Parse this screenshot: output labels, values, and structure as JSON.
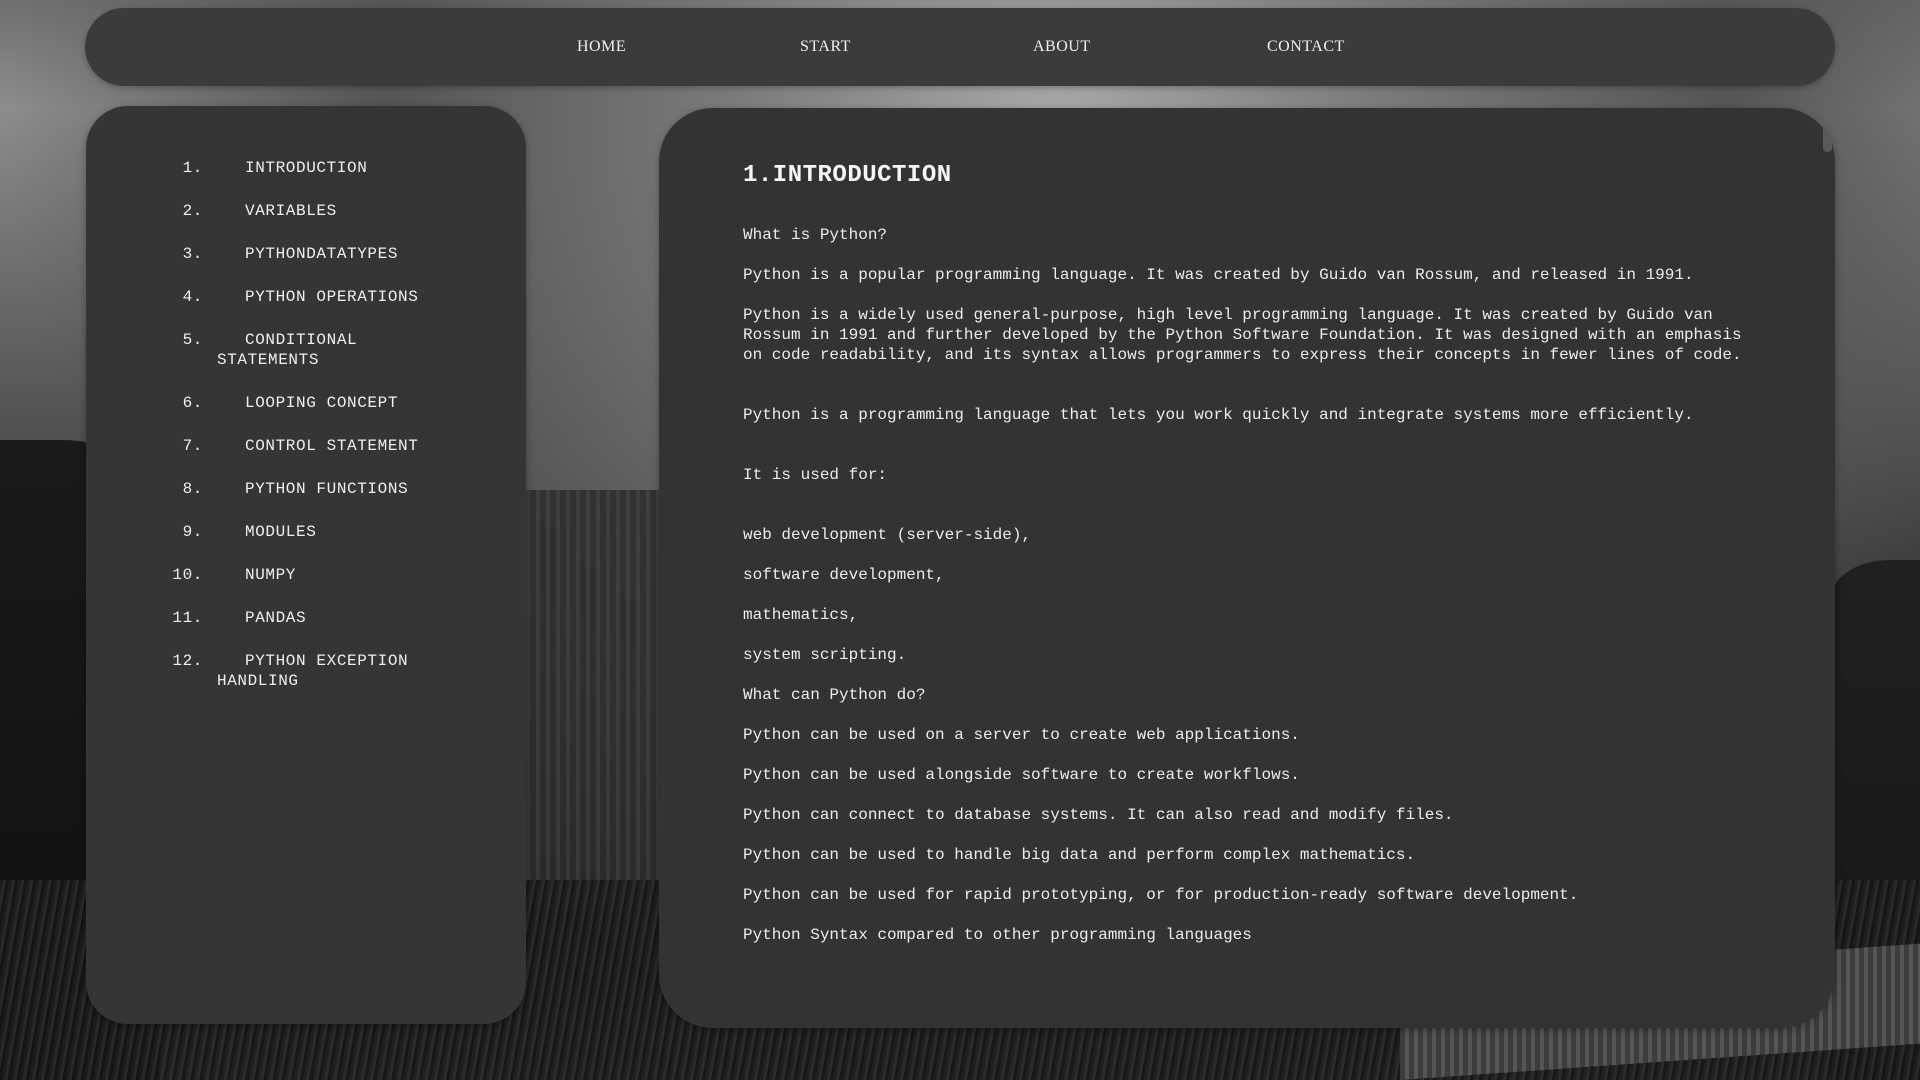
{
  "nav": {
    "items": [
      "HOME",
      "START",
      "ABOUT",
      "CONTACT"
    ]
  },
  "sidebar": {
    "items": [
      {
        "num": "1.",
        "label": "INTRODUCTION"
      },
      {
        "num": "2.",
        "label": "VARIABLES"
      },
      {
        "num": "3.",
        "label": "PYTHONDATATYPES"
      },
      {
        "num": "4.",
        "label": "PYTHON OPERATIONS"
      },
      {
        "num": "5.",
        "label": "CONDITIONAL STATEMENTS"
      },
      {
        "num": "6.",
        "label": "LOOPING CONCEPT"
      },
      {
        "num": "7.",
        "label": "CONTROL STATEMENT"
      },
      {
        "num": "8.",
        "label": "PYTHON FUNCTIONS"
      },
      {
        "num": "9.",
        "label": "MODULES"
      },
      {
        "num": "10.",
        "label": "NUMPY"
      },
      {
        "num": "11.",
        "label": "PANDAS"
      },
      {
        "num": "12.",
        "label": "PYTHON EXCEPTION HANDLING"
      }
    ]
  },
  "main": {
    "title": "1.INTRODUCTION",
    "paragraphs": [
      "What is Python?",
      "Python is a popular programming language. It was created by Guido van Rossum, and released in 1991.",
      "Python is a widely used general-purpose, high level programming language. It was created by Guido van Rossum in 1991 and further developed by the Python Software Foundation. It was designed with an emphasis on code readability, and its syntax allows programmers to express their concepts in fewer lines of code.",
      "Python is a programming language that lets you work quickly and integrate systems more efficiently.",
      "It is used for:",
      "web development (server-side),",
      "software development,",
      "mathematics,",
      "system scripting.",
      "What can Python do?",
      "Python can be used on a server to create web applications.",
      "Python can be used alongside software to create workflows.",
      "Python can connect to database systems. It can also read and modify files.",
      "Python can be used to handle big data and perform complex mathematics.",
      "Python can be used for rapid prototyping, or for production-ready software development.",
      "Python Syntax compared to other programming languages"
    ]
  },
  "colors": {
    "panel": "#353535",
    "nav_bar": "#3b3b3b",
    "text": "#ececec"
  }
}
